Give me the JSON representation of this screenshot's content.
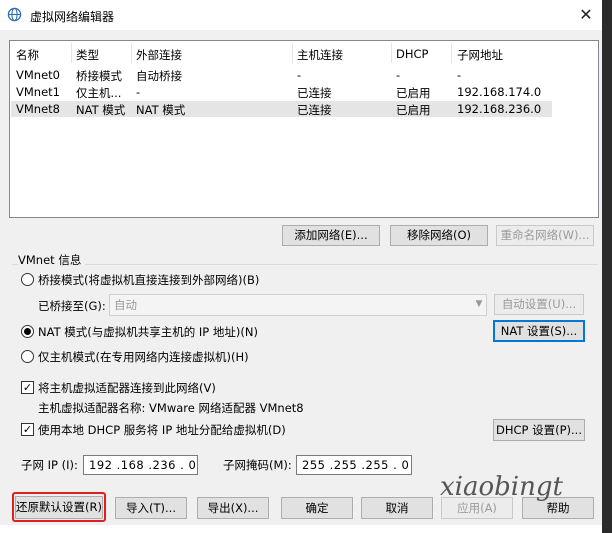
{
  "window": {
    "title": "虚拟网络编辑器",
    "close_glyph": "✕"
  },
  "table": {
    "headers": [
      "名称",
      "类型",
      "外部连接",
      "主机连接",
      "DHCP",
      "子网地址"
    ],
    "rows": [
      {
        "name": "VMnet0",
        "type": "桥接模式",
        "external": "自动桥接",
        "host": "-",
        "dhcp": "-",
        "subnet": "-",
        "selected": false
      },
      {
        "name": "VMnet1",
        "type": "仅主机...",
        "external": "-",
        "host": "已连接",
        "dhcp": "已启用",
        "subnet": "192.168.174.0",
        "selected": false
      },
      {
        "name": "VMnet8",
        "type": "NAT 模式",
        "external": "NAT 模式",
        "host": "已连接",
        "dhcp": "已启用",
        "subnet": "192.168.236.0",
        "selected": true
      }
    ]
  },
  "list_buttons": {
    "add": "添加网络(E)...",
    "remove": "移除网络(O)",
    "rename": "重命名网络(W)..."
  },
  "vmnet_info": {
    "title": "VMnet 信息",
    "bridge_mode": "桥接模式(将虚拟机直接连接到外部网络)(B)",
    "bridged_to_label": "已桥接至(G):",
    "bridged_to_value": "自动",
    "auto_settings": "自动设置(U)...",
    "nat_mode": "NAT 模式(与虚拟机共享主机的 IP 地址)(N)",
    "nat_settings": "NAT 设置(S)...",
    "host_only_mode": "仅主机模式(在专用网络内连接虚拟机)(H)",
    "connect_adapter": "将主机虚拟适配器连接到此网络(V)",
    "adapter_name": "主机虚拟适配器名称: VMware 网络适配器 VMnet8",
    "use_dhcp": "使用本地 DHCP 服务将 IP 地址分配给虚拟机(D)",
    "dhcp_settings": "DHCP 设置(P)...",
    "subnet_ip_label": "子网 IP (I):",
    "subnet_ip": "192 .168 .236 . 0",
    "subnet_mask_label": "子网掩码(M):",
    "subnet_mask": "255 .255 .255 . 0"
  },
  "footer": {
    "restore_defaults": "还原默认设置(R)",
    "import": "导入(T)...",
    "export": "导出(X)...",
    "ok": "确定",
    "cancel": "取消",
    "apply": "应用(A)",
    "help": "帮助"
  },
  "watermark": "xiaobingt",
  "colors": {
    "highlight_box": "#e02020",
    "focus_border": "#0078d7",
    "selected_row": "#e5e5e5"
  }
}
